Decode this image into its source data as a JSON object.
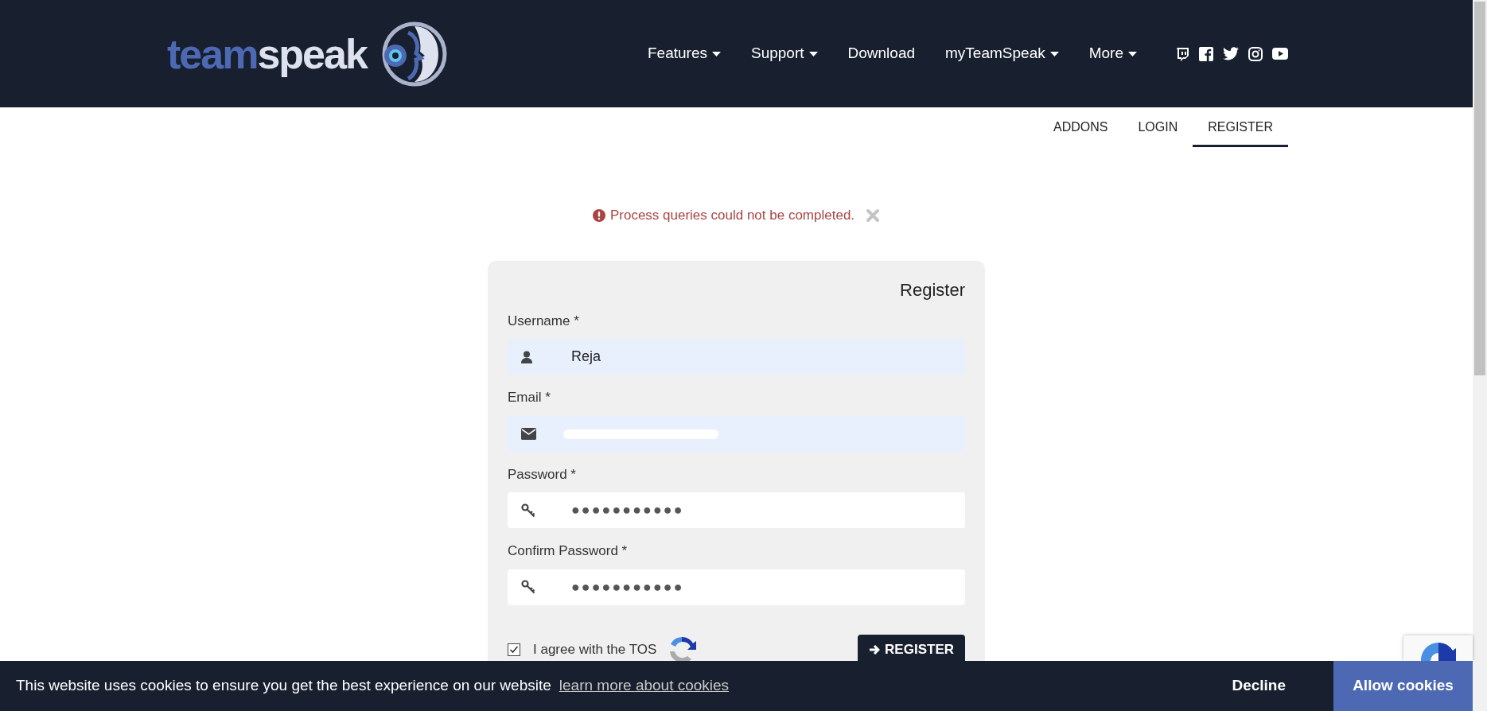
{
  "header": {
    "logo": {
      "part_1": "team",
      "part_2": "speak"
    },
    "nav": [
      {
        "label": "Features",
        "dropdown": true
      },
      {
        "label": "Support",
        "dropdown": true
      },
      {
        "label": "Download",
        "dropdown": false
      },
      {
        "label": "myTeamSpeak",
        "dropdown": true
      },
      {
        "label": "More",
        "dropdown": true
      }
    ]
  },
  "subnav": [
    {
      "label": "ADDONS",
      "selected": false
    },
    {
      "label": "LOGIN",
      "selected": false
    },
    {
      "label": "REGISTER",
      "selected": true
    }
  ],
  "alert": {
    "message": "Process queries could not be completed."
  },
  "form": {
    "title": "Register",
    "fields": [
      {
        "label": "Username *",
        "kind": "user",
        "value": "Reja",
        "autofilled": true
      },
      {
        "label": "Email *",
        "kind": "email",
        "redacted": true,
        "autofilled": true
      },
      {
        "label": "Password *",
        "kind": "password",
        "value": "●●●●●●●●●●●",
        "autofilled": false
      },
      {
        "label": "Confirm Password *",
        "kind": "password",
        "value": "●●●●●●●●●●●",
        "autofilled": false
      }
    ],
    "tos": {
      "label": "I agree with the TOS",
      "checked": true
    },
    "submit": "REGISTER"
  },
  "cookie_bar": {
    "message": "This website uses cookies to ensure you get the best experience on our website",
    "link": "learn more about cookies",
    "decline": "Decline",
    "allow": "Allow cookies"
  }
}
